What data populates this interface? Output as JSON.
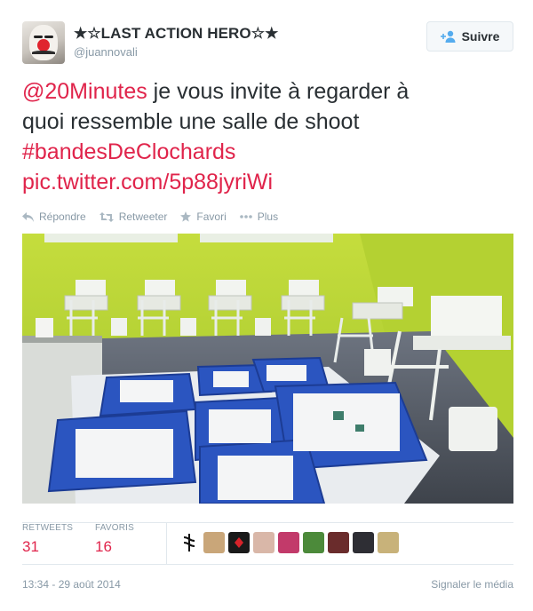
{
  "user": {
    "display_name": "★☆LAST ACTION HERO☆★",
    "handle": "@juannovali",
    "avatar_icon": "anonymous-mask-avatar"
  },
  "follow_button": {
    "label": "Suivre",
    "icon": "add-user-icon"
  },
  "tweet": {
    "mention": "@20Minutes",
    "text_line1_rest": " je vous invite à regarder à",
    "text_line2": "quoi ressemble une salle de shoot",
    "hashtag": "#bandesDeClochards",
    "link": "pic.twitter.com/5p88jyriWi"
  },
  "actions": [
    {
      "label": "Répondre",
      "icon": "reply-icon"
    },
    {
      "label": "Retweeter",
      "icon": "retweet-icon"
    },
    {
      "label": "Favori",
      "icon": "star-icon"
    },
    {
      "label": "Plus",
      "icon": "more-dots-icon"
    }
  ],
  "stats": {
    "retweets_label": "RETWEETS",
    "retweets_count": "31",
    "favorites_label": "FAVORIS",
    "favorites_count": "16"
  },
  "favoriters": [
    {
      "icon": "medical-caduceus-avatar",
      "bg": "#ffffff"
    },
    {
      "icon": "painting-avatar",
      "bg": "#c9a679"
    },
    {
      "icon": "red-card-avatar",
      "bg": "#1a1a1a"
    },
    {
      "icon": "portrait-avatar",
      "bg": "#d9b7a8"
    },
    {
      "icon": "punk-portrait-avatar",
      "bg": "#c23a6a"
    },
    {
      "icon": "green-figure-avatar",
      "bg": "#4c8a3a"
    },
    {
      "icon": "dark-portrait-avatar",
      "bg": "#6a2c2c"
    },
    {
      "icon": "poster-avatar",
      "bg": "#2e2e34"
    },
    {
      "icon": "sketch-avatar",
      "bg": "#c8b27a"
    }
  ],
  "footer": {
    "timestamp": "13:34 - 29 août 2014",
    "report_link": "Signaler le média"
  },
  "colors": {
    "link": "#e0244b",
    "muted": "#8899a6",
    "text": "#292f33",
    "border": "#e1e8ed"
  }
}
